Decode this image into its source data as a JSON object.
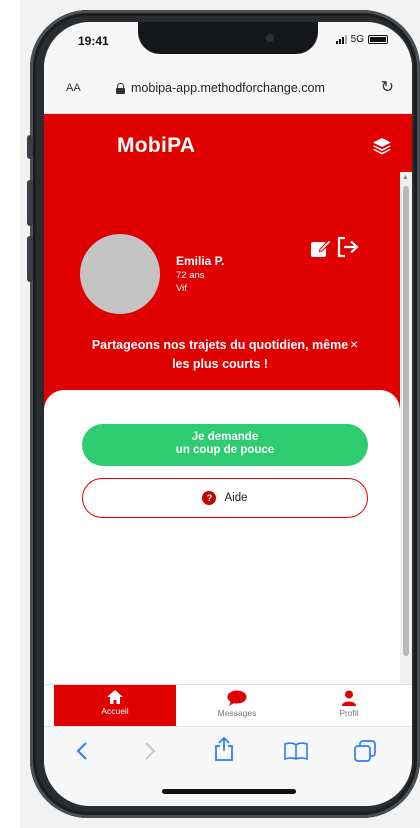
{
  "status_bar": {
    "time": "19:41",
    "network": "5G"
  },
  "browser": {
    "aa_label": "AA",
    "url": "mobipa-app.methodforchange.com"
  },
  "app": {
    "title": "MobiPA"
  },
  "profile": {
    "name": "Emilia P.",
    "age": "72 ans",
    "mood": "Vif"
  },
  "banner": {
    "text": "Partageons nos trajets du quotidien, même les plus courts !",
    "close": "×"
  },
  "actions": {
    "primary_line1": "Je demande",
    "primary_line2": "un coup de pouce",
    "help_label": "Aide",
    "help_icon_glyph": "?"
  },
  "tabs": [
    {
      "label": "Accueil",
      "icon": "home-icon",
      "active": true
    },
    {
      "label": "Messages",
      "icon": "chat-bubble-icon",
      "active": false
    },
    {
      "label": "Profil",
      "icon": "person-icon",
      "active": false
    }
  ],
  "colors": {
    "brand_red": "#e00000",
    "accent_green": "#2ecc71"
  },
  "safari_toolbar": [
    "back-icon",
    "forward-icon",
    "share-icon",
    "bookmarks-icon",
    "tabs-icon"
  ]
}
